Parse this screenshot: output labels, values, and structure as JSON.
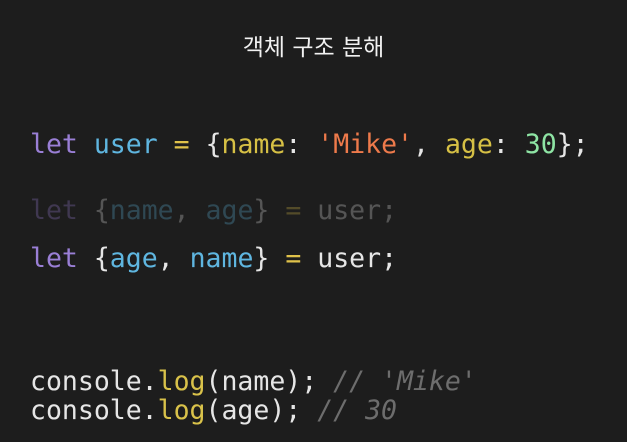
{
  "title": "객체 구조 분해",
  "code": {
    "line1": [
      {
        "t": "let",
        "c": "kw"
      },
      {
        "t": " ",
        "c": "plain"
      },
      {
        "t": "user",
        "c": "var"
      },
      {
        "t": " ",
        "c": "plain"
      },
      {
        "t": "=",
        "c": "op"
      },
      {
        "t": " {",
        "c": "plain"
      },
      {
        "t": "name",
        "c": "prop"
      },
      {
        "t": ": ",
        "c": "plain"
      },
      {
        "t": "'Mike'",
        "c": "str"
      },
      {
        "t": ", ",
        "c": "plain"
      },
      {
        "t": "age",
        "c": "prop"
      },
      {
        "t": ": ",
        "c": "plain"
      },
      {
        "t": "30",
        "c": "num"
      },
      {
        "t": "};",
        "c": "plain"
      }
    ],
    "line2": [
      {
        "t": "let",
        "c": "kw"
      },
      {
        "t": " {",
        "c": "plain"
      },
      {
        "t": "name",
        "c": "var"
      },
      {
        "t": ", ",
        "c": "plain"
      },
      {
        "t": "age",
        "c": "var"
      },
      {
        "t": "} ",
        "c": "plain"
      },
      {
        "t": "=",
        "c": "op"
      },
      {
        "t": " user;",
        "c": "plain"
      }
    ],
    "line3": [
      {
        "t": "let",
        "c": "kw"
      },
      {
        "t": " {",
        "c": "plain"
      },
      {
        "t": "age",
        "c": "var"
      },
      {
        "t": ", ",
        "c": "plain"
      },
      {
        "t": "name",
        "c": "var"
      },
      {
        "t": "} ",
        "c": "plain"
      },
      {
        "t": "=",
        "c": "op"
      },
      {
        "t": " user;",
        "c": "plain"
      }
    ],
    "line4": [
      {
        "t": "console.",
        "c": "plain"
      },
      {
        "t": "log",
        "c": "fn"
      },
      {
        "t": "(name); ",
        "c": "plain"
      },
      {
        "t": "// 'Mike'",
        "c": "cmt"
      }
    ],
    "line5": [
      {
        "t": "console.",
        "c": "plain"
      },
      {
        "t": "log",
        "c": "fn"
      },
      {
        "t": "(age); ",
        "c": "plain"
      },
      {
        "t": "// 30",
        "c": "cmt"
      }
    ]
  }
}
